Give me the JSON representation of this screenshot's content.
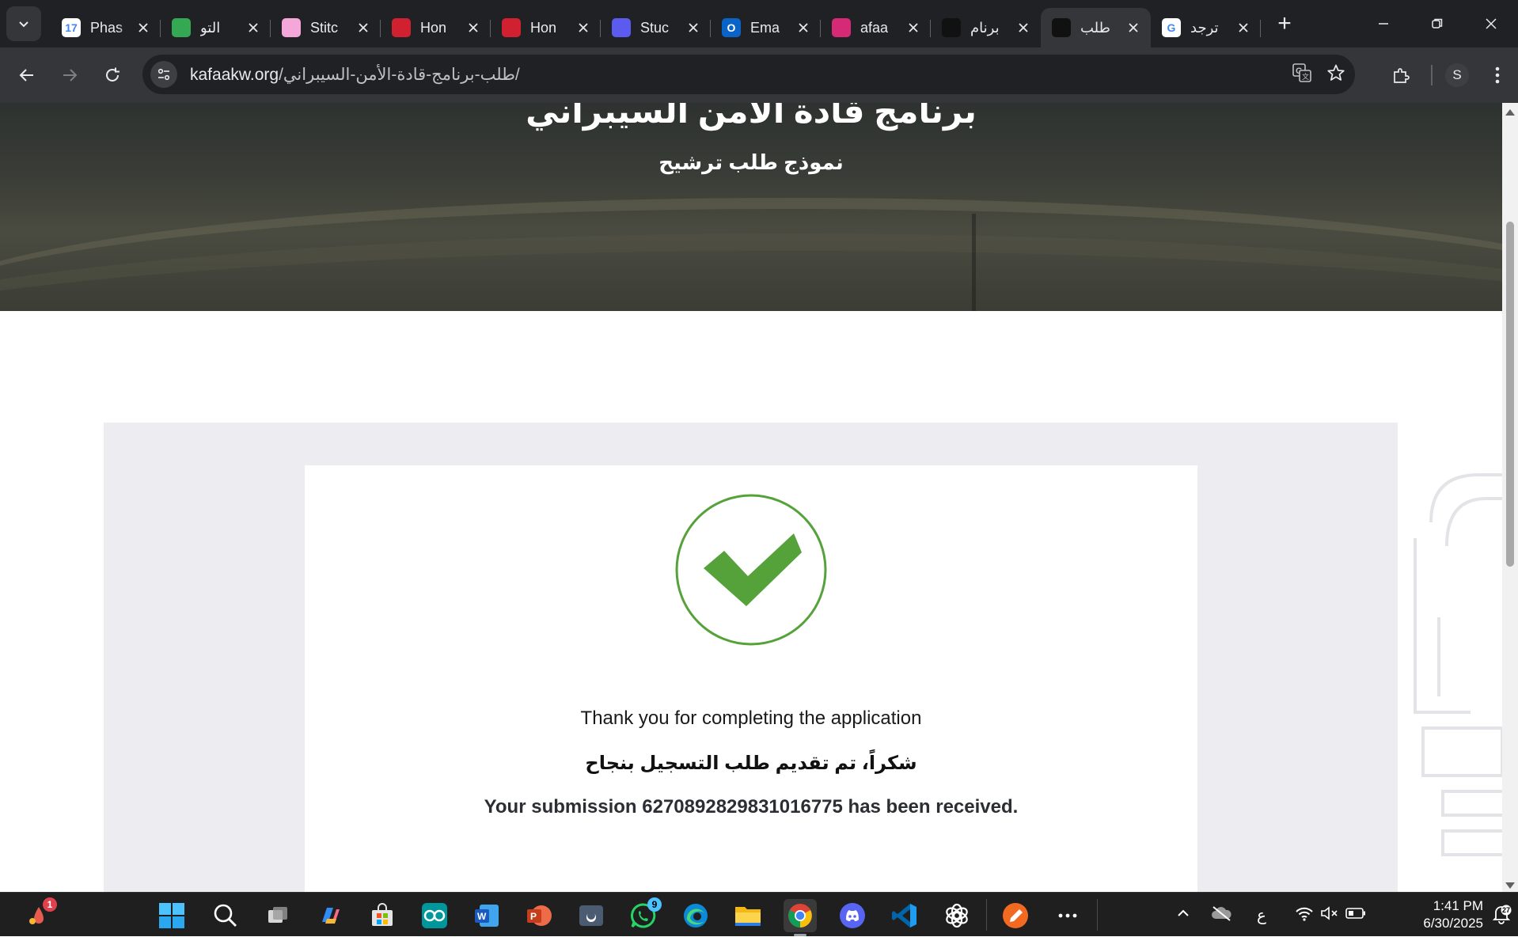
{
  "browser": {
    "tabs": [
      {
        "title": "Phas",
        "favicon": "calendar-icon",
        "favicon_text": "17",
        "color": "#ffffff"
      },
      {
        "title": "التو",
        "favicon": "green-swirl-icon",
        "favicon_text": "",
        "color": "#34a853"
      },
      {
        "title": "Stitc",
        "favicon": "flask-icon",
        "favicon_text": "",
        "color": "#f4a7d8"
      },
      {
        "title": "Hon",
        "favicon": "wing-logo-icon",
        "favicon_text": "",
        "color": "#d1202f"
      },
      {
        "title": "Hon",
        "favicon": "wing-logo-icon",
        "favicon_text": "",
        "color": "#d1202f"
      },
      {
        "title": "Stuc",
        "favicon": "circle-check-icon",
        "favicon_text": "",
        "color": "#5b5bf0"
      },
      {
        "title": "Ema",
        "favicon": "outlook-icon",
        "favicon_text": "O",
        "color": "#0a64c8"
      },
      {
        "title": "afaa",
        "favicon": "instagram-icon",
        "favicon_text": "",
        "color": "#d62976"
      },
      {
        "title": "برنام",
        "favicon": "kafaa-logo-icon",
        "favicon_text": "",
        "color": "#111111"
      },
      {
        "title": "طلب",
        "favicon": "kafaa-logo-icon",
        "favicon_text": "",
        "color": "#111111",
        "active": true
      },
      {
        "title": "ترجد",
        "favicon": "google-icon",
        "favicon_text": "G",
        "color": "#ffffff"
      }
    ],
    "url_host": "kafaakw.org",
    "url_path": "/طلب-برنامج-قادة-الأمن-السيبراني/",
    "profile_initial": "S"
  },
  "page": {
    "hero_title": "برنامج قادة الأمن السيبراني",
    "hero_subtitle": "نموذج طلب ترشيح",
    "thank_you_en": "Thank you for completing the application",
    "thank_you_ar": "شكراً، تم تقديم طلب التسجيل بنجاح",
    "submission_text": "Your submission 6270892829831016775 has been received.",
    "check_color": "#56a23a"
  },
  "taskbar": {
    "weather_badge": "1",
    "whatsapp_badge": "9",
    "language": "ع",
    "time": "1:41 PM",
    "date": "6/30/2025",
    "notification_count": "27"
  }
}
